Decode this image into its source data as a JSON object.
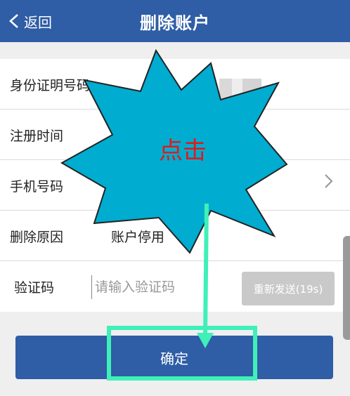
{
  "header": {
    "back_label": "返回",
    "title": "删除账户"
  },
  "form": {
    "id_label": "身份证明号码",
    "reg_time_label": "注册时间",
    "phone_label": "手机号码",
    "reason_label": "删除原因",
    "reason_value": "账户停用",
    "code_label": "验证码",
    "code_placeholder": "请输入验证码",
    "resend_label": "重新发送(19s)"
  },
  "confirm_label": "确定",
  "annotation": {
    "text": "点击"
  },
  "colors": {
    "header_bg": "#2f5da6",
    "burst_fill": "#00acd0",
    "highlight": "#3ff0b8",
    "annotation_text": "#e01a1a"
  }
}
